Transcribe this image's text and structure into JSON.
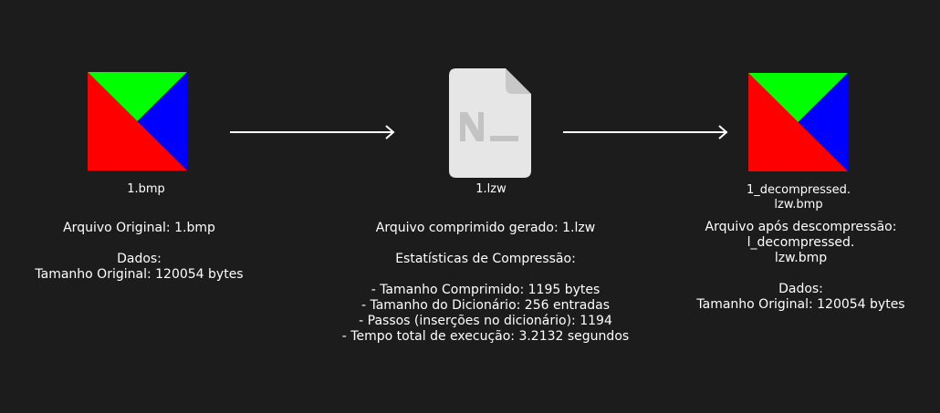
{
  "colors": {
    "background": "#1c1c1c",
    "red": "#ff0000",
    "green": "#00ff00",
    "blue": "#0000ff",
    "file_icon": "#e6e6e6",
    "file_fold": "#c8c8c8",
    "file_glyph": "#c3c3c3",
    "arrow": "#ffffff"
  },
  "input": {
    "icon": "bitmap-image-icon",
    "filename": "1.bmp",
    "info_lines": [
      "Arquivo Original: 1.bmp",
      "",
      "Dados:",
      "Tamanho Original: 120054 bytes"
    ]
  },
  "compressed": {
    "icon": "file-document-icon",
    "filename": "1.lzw",
    "info_lines": [
      "Arquivo comprimido gerado: 1.lzw",
      "",
      "Estatísticas de Compressão:",
      "",
      "- Tamanho Comprimido: 1195 bytes",
      "- Tamanho do Dicionário: 256 entradas",
      "- Passos (inserções no dicionário): 1194",
      "- Tempo total de execução: 3.2132 segundos"
    ]
  },
  "output": {
    "icon": "bitmap-image-icon",
    "filename_lines": [
      "1_decompressed.",
      "lzw.bmp"
    ],
    "info_lines": [
      "Arquivo após descompressão:",
      "l_decompressed.",
      "lzw.bmp",
      "",
      "Dados:",
      "Tamanho Original: 120054 bytes"
    ]
  },
  "arrows": [
    "arrow-right-icon",
    "arrow-right-icon"
  ]
}
